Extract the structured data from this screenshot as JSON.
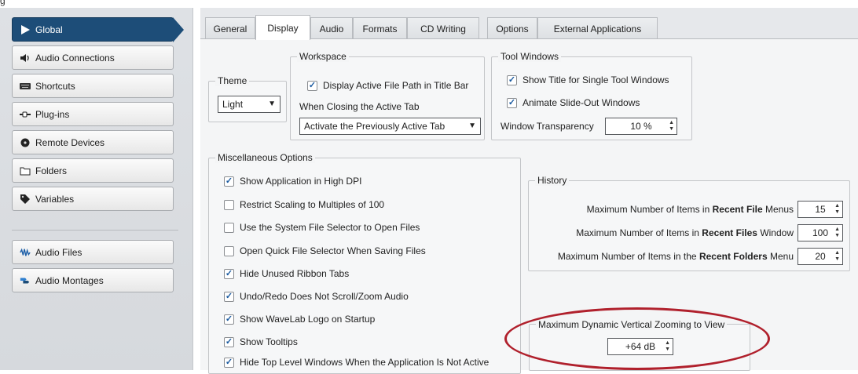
{
  "sidebar": {
    "items": [
      {
        "label": "Global",
        "icon": "play-icon",
        "active": true
      },
      {
        "label": "Audio Connections",
        "icon": "speaker-icon"
      },
      {
        "label": "Shortcuts",
        "icon": "keyboard-icon"
      },
      {
        "label": "Plug-ins",
        "icon": "plug-icon"
      },
      {
        "label": "Remote Devices",
        "icon": "remote-device-icon"
      },
      {
        "label": "Folders",
        "icon": "folder-icon"
      },
      {
        "label": "Variables",
        "icon": "tag-icon"
      }
    ],
    "items2": [
      {
        "label": "Audio Files",
        "icon": "waveform-icon"
      },
      {
        "label": "Audio Montages",
        "icon": "montage-icon"
      }
    ]
  },
  "tabs": [
    "General",
    "Display",
    "Audio",
    "Formats",
    "CD Writing",
    "Options",
    "External Applications"
  ],
  "active_tab": "Display",
  "theme": {
    "title": "Theme",
    "value": "Light"
  },
  "workspace": {
    "title": "Workspace",
    "display_path_label": "Display Active File Path in Title Bar",
    "display_path_checked": true,
    "closing_label": "When Closing the Active Tab",
    "closing_value": "Activate the Previously Active Tab"
  },
  "tool_windows": {
    "title": "Tool Windows",
    "show_title_label": "Show Title for Single Tool Windows",
    "show_title_checked": true,
    "animate_label": "Animate Slide-Out Windows",
    "animate_checked": true,
    "transparency_label": "Window Transparency",
    "transparency_value": "10 %"
  },
  "misc": {
    "title": "Miscellaneous Options",
    "options": [
      {
        "label": "Show Application in High DPI",
        "checked": true
      },
      {
        "label": "Restrict Scaling to Multiples of 100",
        "checked": false
      },
      {
        "label": "Use the System File Selector to Open Files",
        "checked": false
      },
      {
        "label": "Open Quick File Selector When Saving Files",
        "checked": false
      },
      {
        "label": "Hide Unused Ribbon Tabs",
        "checked": true
      },
      {
        "label": "Undo/Redo Does Not Scroll/Zoom Audio",
        "checked": true
      },
      {
        "label": "Show WaveLab Logo on Startup",
        "checked": true
      },
      {
        "label": "Show Tooltips",
        "checked": true
      },
      {
        "label": "Hide Top Level Windows When the Application Is Not Active",
        "checked": true
      }
    ]
  },
  "history": {
    "title": "History",
    "rows": [
      {
        "prefix": "Maximum Number of Items in ",
        "bold": "Recent File",
        "suffix": " Menus",
        "value": "15"
      },
      {
        "prefix": "Maximum Number of Items in ",
        "bold": "Recent Files",
        "suffix": " Window",
        "value": "100"
      },
      {
        "prefix": "Maximum Number of Items in the ",
        "bold": "Recent Folders",
        "suffix": " Menu",
        "value": "20"
      }
    ]
  },
  "zoom": {
    "title": "Maximum Dynamic Vertical Zooming to View",
    "value": "+64 dB"
  },
  "colors": {
    "accent": "#1d4d78",
    "highlight_ring": "#b0202c"
  }
}
